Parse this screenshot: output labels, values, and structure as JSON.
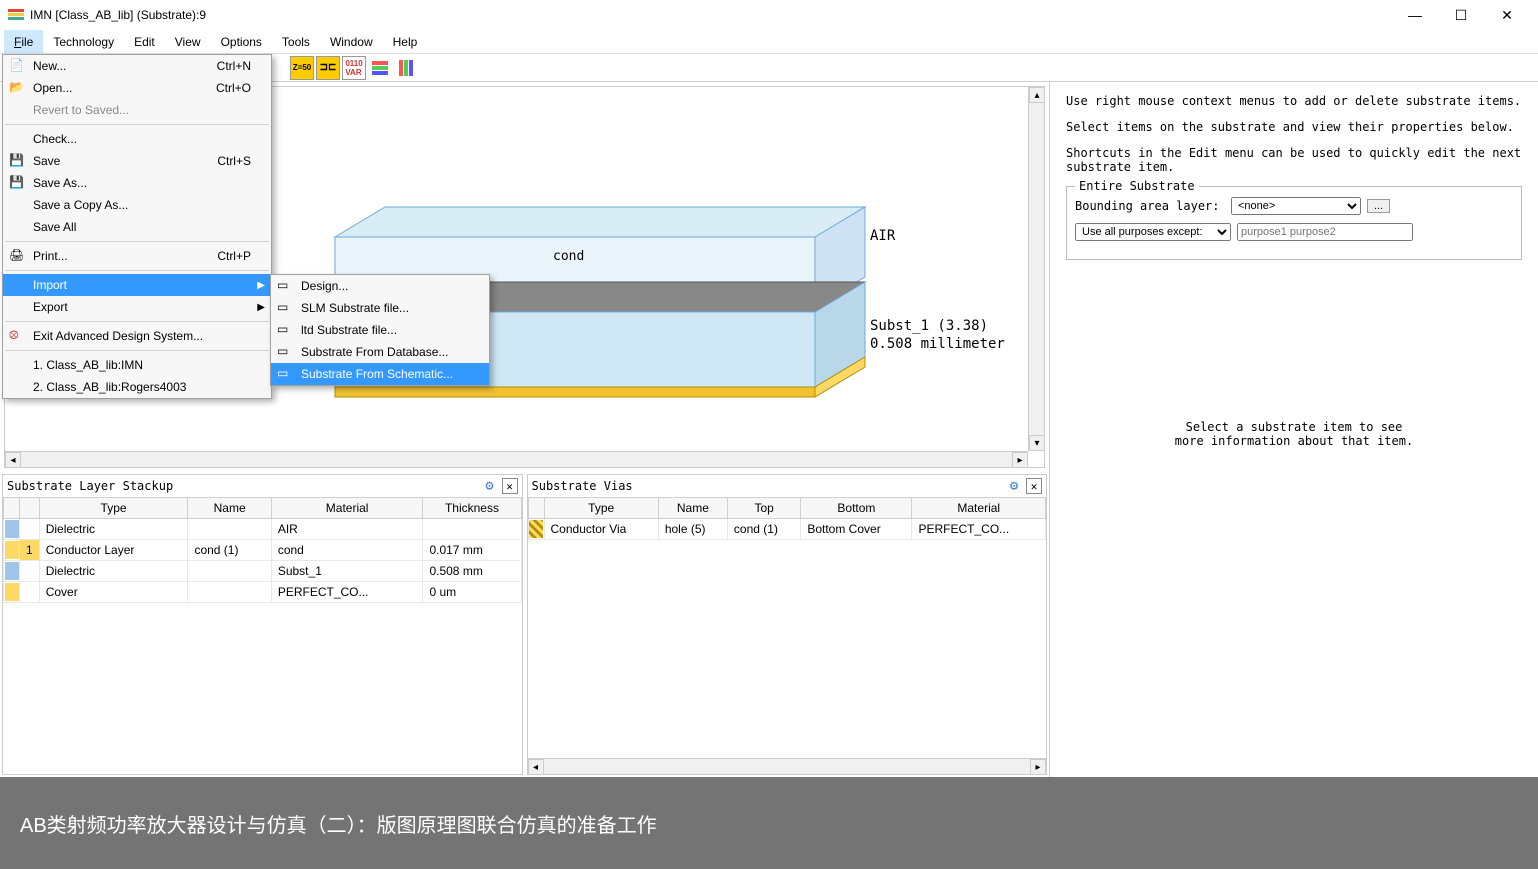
{
  "window": {
    "title": "IMN [Class_AB_lib] (Substrate):9"
  },
  "menubar": [
    "File",
    "Technology",
    "Edit",
    "View",
    "Options",
    "Tools",
    "Window",
    "Help"
  ],
  "file_menu": {
    "new": "New...",
    "new_sc": "Ctrl+N",
    "open": "Open...",
    "open_sc": "Ctrl+O",
    "revert": "Revert to Saved...",
    "check": "Check...",
    "save": "Save",
    "save_sc": "Ctrl+S",
    "save_as": "Save As...",
    "save_copy": "Save a Copy As...",
    "save_all": "Save All",
    "print": "Print...",
    "print_sc": "Ctrl+P",
    "import": "Import",
    "export": "Export",
    "exit": "Exit Advanced Design System...",
    "recent1": "1. Class_AB_lib:IMN",
    "recent2": "2. Class_AB_lib:Rogers4003"
  },
  "import_submenu": {
    "design": "Design...",
    "slm": "SLM Substrate file...",
    "ltd": "ltd Substrate file...",
    "db": "Substrate From Database...",
    "schem": "Substrate From Schematic..."
  },
  "canvas": {
    "air": "AIR",
    "cond": "cond",
    "subst_line1": "Subst_1 (3.38)",
    "subst_line2": "0.508 millimeter"
  },
  "right_panel": {
    "hint1": "Use right mouse context menus to add or delete substrate items.",
    "hint2": "Select items on the substrate and view their properties below.",
    "hint3": "Shortcuts in the Edit menu can be used to quickly edit the next substrate item.",
    "legend": "Entire Substrate",
    "bounding_label": "Bounding area layer:",
    "bounding_value": "<none>",
    "purposes_label": "Use all purposes except:",
    "purposes_placeholder": "purpose1 purpose2",
    "browse": "...",
    "info1": "Select a substrate item to see",
    "info2": "more information about that item."
  },
  "stackup": {
    "title": "Substrate Layer Stackup",
    "cols": [
      "Type",
      "Name",
      "Material",
      "Thickness"
    ],
    "rows": [
      {
        "color": "#9fc5e8",
        "idx": "",
        "type": "Dielectric",
        "name": "",
        "material": "AIR",
        "thickness": ""
      },
      {
        "color": "#ffd966",
        "idx": "1",
        "type": "Conductor Layer",
        "name": "cond (1)",
        "material": "cond",
        "thickness": "0.017 mm"
      },
      {
        "color": "#9fc5e8",
        "idx": "",
        "type": "Dielectric",
        "name": "",
        "material": "Subst_1",
        "thickness": "0.508 mm"
      },
      {
        "color": "#ffd966",
        "idx": "",
        "type": "Cover",
        "name": "",
        "material": "PERFECT_CO...",
        "thickness": "0 um"
      }
    ]
  },
  "vias": {
    "title": "Substrate Vias",
    "cols": [
      "Type",
      "Name",
      "Top",
      "Bottom",
      "Material"
    ],
    "rows": [
      {
        "type": "Conductor Via",
        "name": "hole (5)",
        "top": "cond (1)",
        "bottom": "Bottom Cover",
        "material": "PERFECT_CO..."
      }
    ]
  },
  "footer": "AB类射频功率放大器设计与仿真（二）：版图原理图联合仿真的准备工作"
}
